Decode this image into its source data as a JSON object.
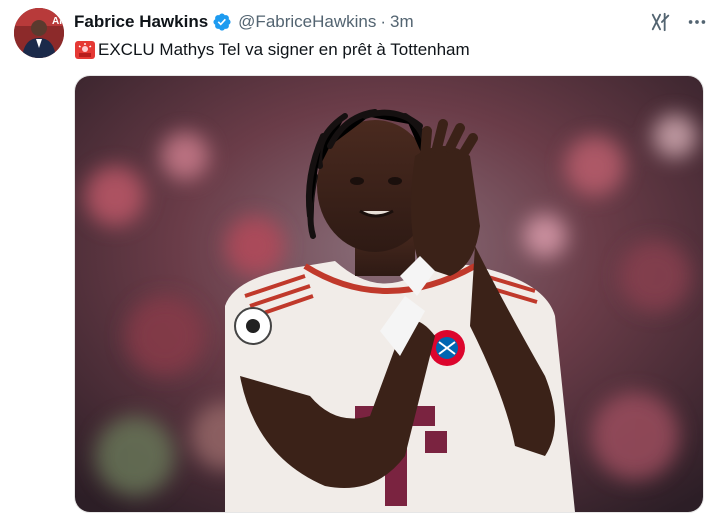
{
  "tweet": {
    "author_name": "Fabrice Hawkins",
    "handle": "@FabriceHawkins",
    "separator": "·",
    "timestamp": "3m",
    "text": "EXCLU Mathys Tel va signer en prêt à Tottenham",
    "icons": {
      "avatar": "avatar",
      "verified": "verified-badge-icon",
      "grok": "grok-icon",
      "more": "more-options-icon",
      "siren": "siren-emoji-icon"
    }
  },
  "photo": {
    "description_kind": "player-photo",
    "jersey_letter": "T"
  },
  "colors": {
    "verified_blue": "#1d9bf0",
    "secondary_text": "#536471",
    "primary_text": "#0f1419"
  }
}
